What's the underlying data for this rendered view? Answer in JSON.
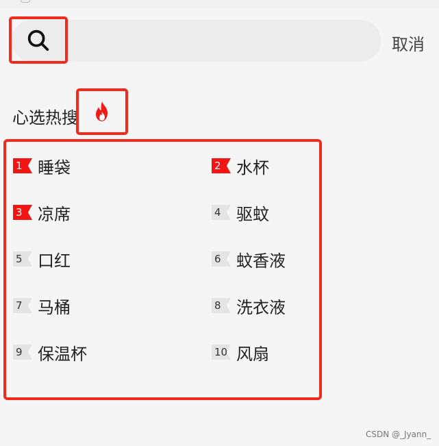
{
  "search": {
    "placeholder": "",
    "cancel_label": "取消"
  },
  "hot_section": {
    "title": "心选热搜",
    "items": [
      {
        "rank": "1",
        "term": "睡袋",
        "highlight": true
      },
      {
        "rank": "2",
        "term": "水杯",
        "highlight": true
      },
      {
        "rank": "3",
        "term": "凉席",
        "highlight": true
      },
      {
        "rank": "4",
        "term": "驱蚊",
        "highlight": false
      },
      {
        "rank": "5",
        "term": "口红",
        "highlight": false
      },
      {
        "rank": "6",
        "term": "蚊香液",
        "highlight": false
      },
      {
        "rank": "7",
        "term": "马桶",
        "highlight": false
      },
      {
        "rank": "8",
        "term": "洗衣液",
        "highlight": false
      },
      {
        "rank": "9",
        "term": "保温杯",
        "highlight": false
      },
      {
        "rank": "10",
        "term": "风扇",
        "highlight": false
      }
    ]
  },
  "watermark": "CSDN @_Jyann_",
  "colors": {
    "annotation_red": "#f22a1e",
    "rank_top": "#f31414",
    "rank_plain": "#e4e4e4",
    "background": "#f5f5f5"
  },
  "icons": {
    "search": "search-icon",
    "fire": "fire-icon"
  }
}
